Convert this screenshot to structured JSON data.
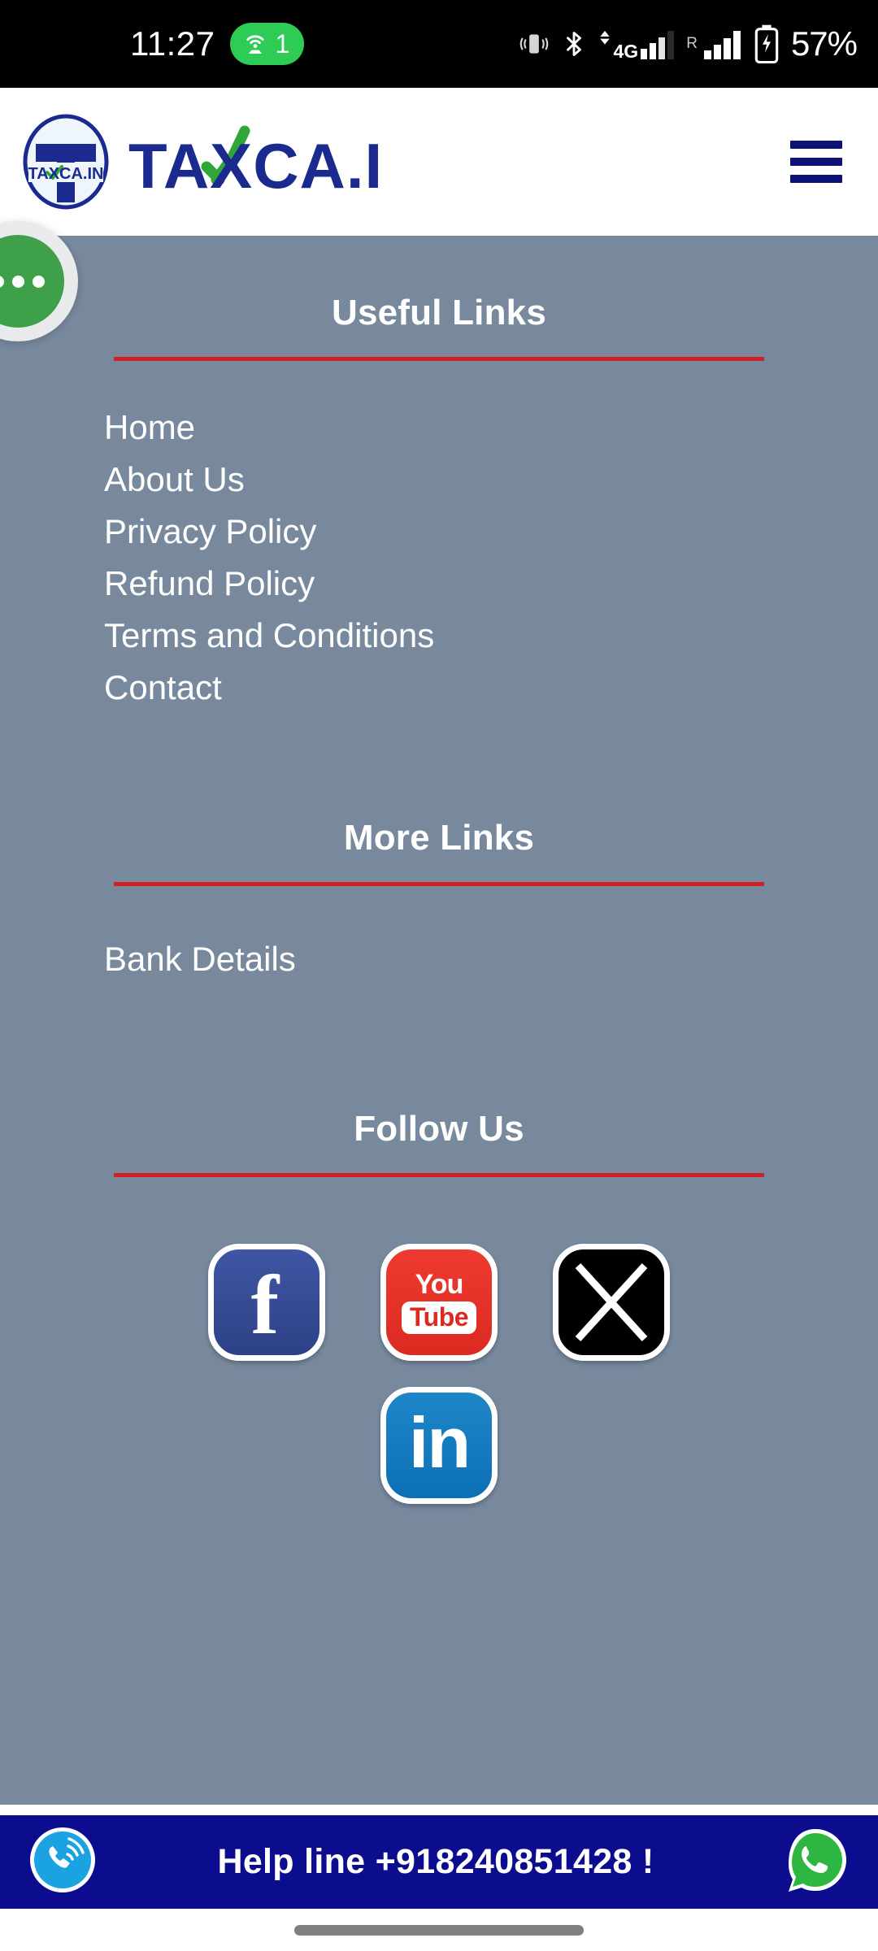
{
  "status_bar": {
    "clock": "11:27",
    "hotspot_count": "1",
    "hotspot_icon": "wifi-hotspot-icon",
    "vibrate_icon": "vibrate-icon",
    "bluetooth_icon": "bluetooth-icon",
    "network_label": "4G",
    "roaming_label": "R",
    "battery_icon": "battery-charging-icon",
    "battery_percent": "57%"
  },
  "header": {
    "logo_mark_text": "TAXCA.IN",
    "logo_word": "TAXCA.IN",
    "logo_word_before": "TA",
    "logo_word_x": "X",
    "logo_word_after": "CA.IN",
    "menu_icon": "hamburger-menu-icon",
    "brand_color": "#1a2a8f",
    "check_color": "#2ea63a"
  },
  "fab": {
    "name": "chat-options-fab",
    "color": "#3fa04a",
    "dots": 3
  },
  "footer": {
    "background_color": "#78899e",
    "divider_color": "#cf2027",
    "sections": [
      {
        "title": "Useful Links",
        "links": [
          "Home",
          "About Us",
          "Privacy Policy",
          "Refund Policy",
          "Terms and Conditions",
          "Contact"
        ]
      },
      {
        "title": "More Links",
        "links": [
          "Bank Details"
        ]
      },
      {
        "title": "Follow Us",
        "links": []
      }
    ],
    "social": [
      {
        "name": "facebook",
        "glyph": "f",
        "color": "#3b5998"
      },
      {
        "name": "youtube",
        "top": "You",
        "bottom": "Tube",
        "color": "#dc2a21"
      },
      {
        "name": "x-twitter",
        "glyph": "X",
        "color": "#000000"
      },
      {
        "name": "linkedin",
        "glyph": "in",
        "color": "#0c70b5"
      }
    ]
  },
  "helpline": {
    "text": "Help line +918240851428 !",
    "background_color": "#0c0c8f",
    "call_icon": "phone-ringing-icon",
    "whatsapp_icon": "whatsapp-icon"
  },
  "gesture_bar": {
    "indicator": "home-gesture-pill"
  }
}
